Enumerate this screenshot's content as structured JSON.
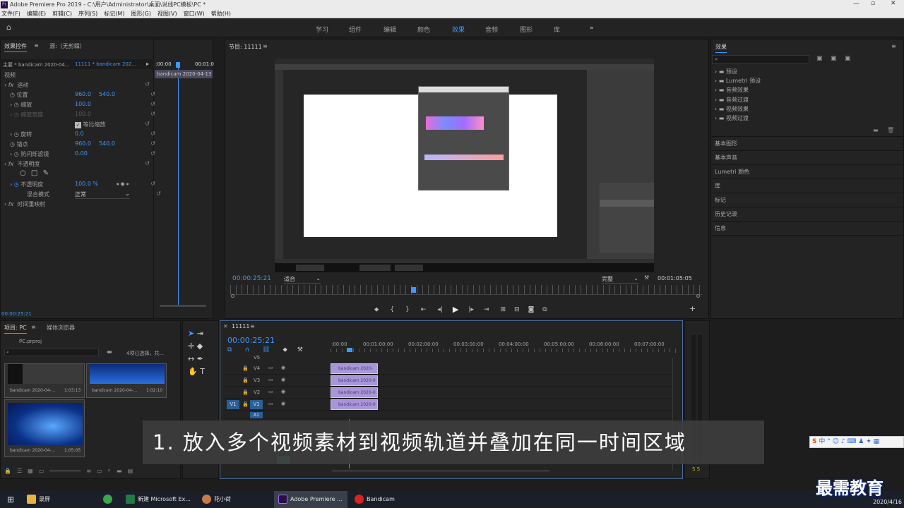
{
  "window": {
    "title": "Adobe Premiere Pro 2019 - C:\\用户\\Administrator\\桌面\\说线PC模板\\PC *"
  },
  "menu": [
    "文件(F)",
    "编辑(E)",
    "剪辑(C)",
    "序列(S)",
    "标记(M)",
    "图形(G)",
    "视图(V)",
    "窗口(W)",
    "帮助(H)"
  ],
  "workspaces": {
    "tabs": [
      "学习",
      "组件",
      "编辑",
      "颜色",
      "效果",
      "音频",
      "图形",
      "库"
    ],
    "active": "效果",
    "more": "»"
  },
  "effect_controls": {
    "tab": "效果控件",
    "source_tab": "源:（无剪辑）",
    "master": "主要 * bandicam 2020-04...",
    "sequence": "11111 * bandicam 202...",
    "time_start": ":00:00",
    "time_end": "00:01:0",
    "clip_label": "bandicam 2020-04-13 1",
    "video_header": "视频",
    "motion": "运动",
    "props": [
      {
        "label": "位置",
        "v1": "960.0",
        "v2": "540.0"
      },
      {
        "label": "缩放",
        "v1": "100.0",
        "v2": ""
      },
      {
        "label": "缩放宽度",
        "v1": "100.0",
        "v2": ""
      },
      {
        "label": "等比缩放",
        "v1": "",
        "v2": ""
      },
      {
        "label": "旋转",
        "v1": "0.0",
        "v2": ""
      },
      {
        "label": "锚点",
        "v1": "960.0",
        "v2": "540.0"
      },
      {
        "label": "防闪烁滤镜",
        "v1": "0.00",
        "v2": ""
      }
    ],
    "opacity": "不透明度",
    "opacity_value": {
      "label": "不透明度",
      "value": "100.0 %"
    },
    "blend": {
      "label": "混合模式",
      "value": "正常"
    },
    "timeremap": "时间重映射",
    "timecode": "00:00:25:21"
  },
  "program": {
    "title": "节目: 11111",
    "timecode": "00:00:25:21",
    "fit": "适合",
    "quality": "完整",
    "duration": "00:01:05:05"
  },
  "project": {
    "tab": "项目: PC",
    "browser_tab": "媒体浏览器",
    "file": "PC.prproj",
    "selected": "4项已选择，共...",
    "items": [
      {
        "name": "bandicam 2020-04-...",
        "dur": "1:03:13"
      },
      {
        "name": "bandicam 2020-04-...",
        "dur": "1:02:10"
      },
      {
        "name": "bandicam 2020-04-...",
        "dur": "1:05:05"
      }
    ]
  },
  "timeline": {
    "tab": "11111",
    "timecode": "00:00:25:21",
    "ticks": [
      ":00:00",
      "00:01:00:00",
      "00:02:00:00",
      "00:03:00:00",
      "00:04:00:00",
      "00:05:00:00",
      "00:06:00:00",
      "00:07:00:00"
    ],
    "tracks": [
      {
        "name": "V5",
        "clip": ""
      },
      {
        "name": "V4",
        "clip": "bandicam 2020-"
      },
      {
        "name": "V3",
        "clip": "bandicam 2020-0"
      },
      {
        "name": "V2",
        "clip": "bandicam 2020-0"
      },
      {
        "name": "V1",
        "clip": "bandicam 2020-0"
      },
      {
        "name": "A1",
        "clip": ""
      }
    ],
    "source_patch": "V1"
  },
  "effects": {
    "title": "效果",
    "folders": [
      "预设",
      "Lumetri 预设",
      "音频效果",
      "音频过渡",
      "视频效果",
      "视频过渡"
    ],
    "panels": [
      "基本图形",
      "基本声音",
      "Lumetri 颜色",
      "库",
      "标记",
      "历史记录",
      "信息"
    ]
  },
  "subtitle": "1. 放入多个视频素材到视频轨道并叠加在同一时间区域",
  "watermark": "最需教育",
  "taskbar": {
    "items": [
      "录屏",
      "新建 Microsoft Ex...",
      "花小荷",
      "Adobe Premiere ...",
      "Bandicam"
    ],
    "ime": "中",
    "date": "2020/4/16"
  },
  "colors": {
    "accent": "#3d98ff",
    "clip": "#a996d9"
  }
}
